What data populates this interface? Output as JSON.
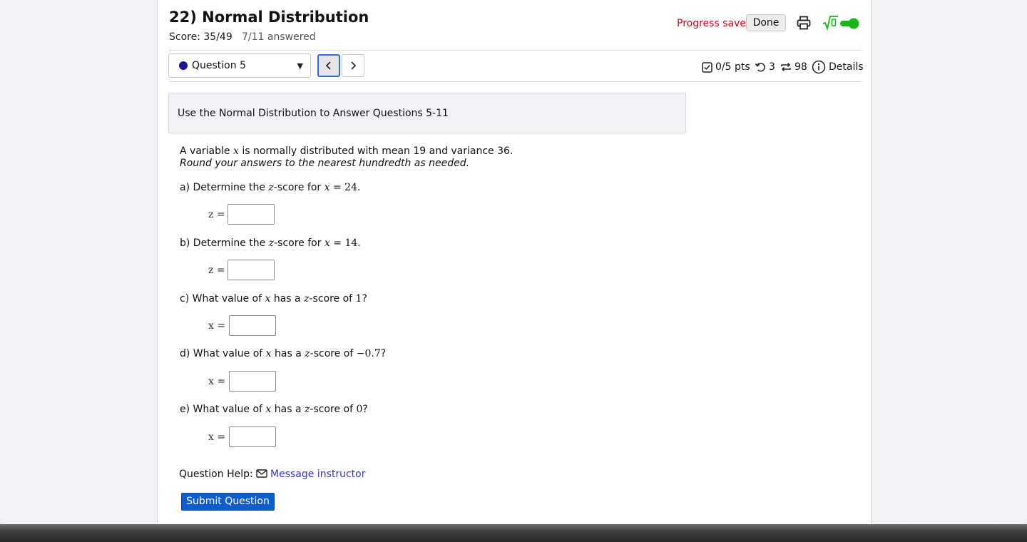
{
  "header": {
    "title": "22) Normal Distribution",
    "score": "Score: 35/49",
    "answered": "7/11 answered",
    "progress_status": "Progress saved",
    "done_label": "Done"
  },
  "nav": {
    "question_select": "Question 5",
    "prev_glyph": "‹",
    "next_glyph": "›"
  },
  "meta": {
    "points": "0/5 pts",
    "retries": "3",
    "attempts": "98",
    "details": "Details"
  },
  "info": {
    "text": "Use the Normal Distribution to Answer Questions 5-11"
  },
  "question": {
    "intro_pre": "A variable ",
    "intro_var": "x",
    "intro_post": " is normally distributed with mean 19 and variance 36.",
    "instruction": "Round your answers to the nearest hundredth as needed.",
    "parts": [
      {
        "pre": "a) Determine the ",
        "v1": "z",
        "mid": "-score for ",
        "v2": "x",
        "eq": " = ",
        "val": "24",
        "end": ".",
        "label": "z =",
        "value": ""
      },
      {
        "pre": "b) Determine the ",
        "v1": "z",
        "mid": "-score for ",
        "v2": "x",
        "eq": " = ",
        "val": "14",
        "end": ".",
        "label": "z =",
        "value": ""
      },
      {
        "pre": "c) What value of ",
        "v1": "x",
        "mid": " has a ",
        "v2": "z",
        "eq": "-score of ",
        "val": "1",
        "end": "?",
        "label": "x =",
        "value": ""
      },
      {
        "pre": "d) What value of ",
        "v1": "x",
        "mid": " has a ",
        "v2": "z",
        "eq": "-score of ",
        "val": "−0.7",
        "end": "?",
        "label": "x =",
        "value": ""
      },
      {
        "pre": "e) What value of ",
        "v1": "x",
        "mid": " has a ",
        "v2": "z",
        "eq": "-score of ",
        "val": "0",
        "end": "?",
        "label": "x =",
        "value": ""
      }
    ]
  },
  "footer": {
    "help_label": "Question Help:",
    "message_link": "Message instructor",
    "submit_label": "Submit Question"
  },
  "colors": {
    "progress": "#d0021b",
    "link": "#3a3ab0",
    "primary": "#0f5ccf",
    "toggle_on": "#1bb41b"
  }
}
